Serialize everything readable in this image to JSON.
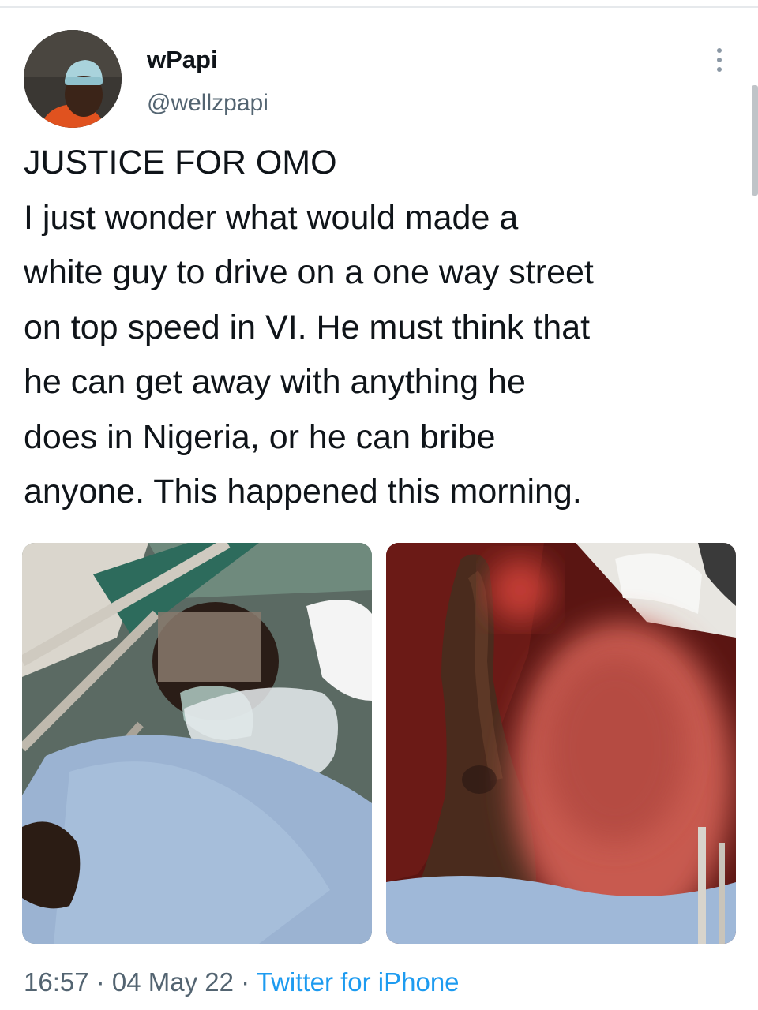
{
  "tweet": {
    "author": {
      "display_name": "wPapi",
      "handle": "@wellzpapi"
    },
    "more_icon": "more-vertical-icon",
    "text_lines": [
      "JUSTICE FOR OMO",
      "I just wonder what would made a",
      "white guy to drive on a one way street",
      "on top speed in VI. He must think that",
      "he can get away with anything he",
      "does in Nigeria, or he can bribe",
      "anyone. This happened this morning."
    ],
    "meta": {
      "time": "16:57",
      "separator": " · ",
      "date": "04 May 22",
      "source": "Twitter for iPhone"
    }
  },
  "colors": {
    "text": "#0f1419",
    "secondary": "#536471",
    "link": "#1d9bf0"
  }
}
